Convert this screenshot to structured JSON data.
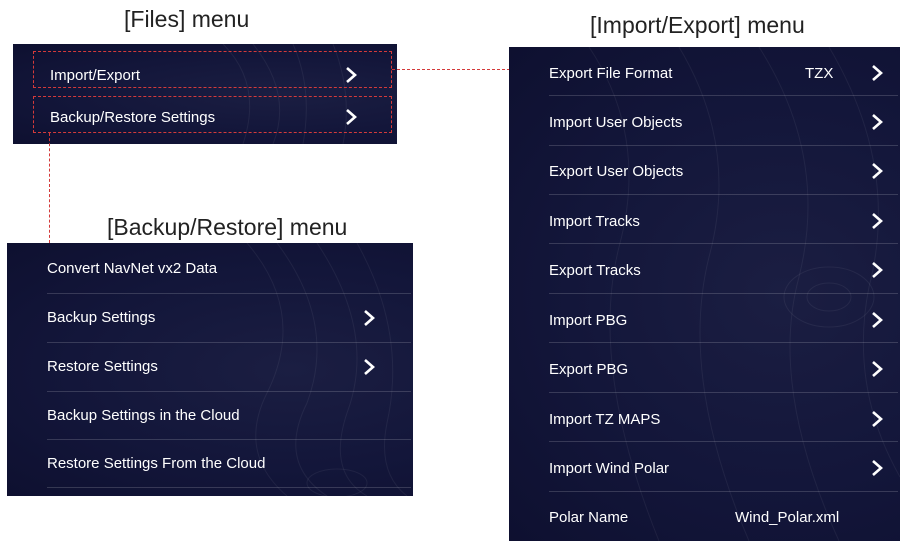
{
  "captions": {
    "files": "[Files] menu",
    "import_export": "[Import/Export] menu",
    "backup_restore": "[Backup/Restore] menu"
  },
  "files_menu": {
    "items": [
      {
        "label": "Import/Export",
        "has_arrow": true
      },
      {
        "label": "Backup/Restore Settings",
        "has_arrow": true
      }
    ]
  },
  "backup_menu": {
    "items": [
      {
        "label": "Convert NavNet vx2 Data",
        "has_arrow": false
      },
      {
        "label": "Backup Settings",
        "has_arrow": true
      },
      {
        "label": "Restore Settings",
        "has_arrow": true
      },
      {
        "label": "Backup Settings in the Cloud",
        "has_arrow": false
      },
      {
        "label": "Restore Settings From the Cloud",
        "has_arrow": false
      }
    ]
  },
  "import_export_menu": {
    "items": [
      {
        "label": "Export File Format",
        "value": "TZX",
        "has_arrow": true
      },
      {
        "label": "Import User Objects",
        "has_arrow": true
      },
      {
        "label": "Export User Objects",
        "has_arrow": true
      },
      {
        "label": "Import Tracks",
        "has_arrow": true
      },
      {
        "label": "Export Tracks",
        "has_arrow": true
      },
      {
        "label": "Import PBG",
        "has_arrow": true
      },
      {
        "label": "Export PBG",
        "has_arrow": true
      },
      {
        "label": "Import TZ MAPS",
        "has_arrow": true
      },
      {
        "label": "Import Wind Polar",
        "has_arrow": true
      },
      {
        "label": "Polar Name",
        "value": "Wind_Polar.xml",
        "has_arrow": false
      }
    ]
  },
  "icons": {
    "arrow": "chevron-right-icon"
  },
  "colors": {
    "panel_bg": "#13163a",
    "text": "#ffffff",
    "callout_dash": "#d43a3a"
  }
}
